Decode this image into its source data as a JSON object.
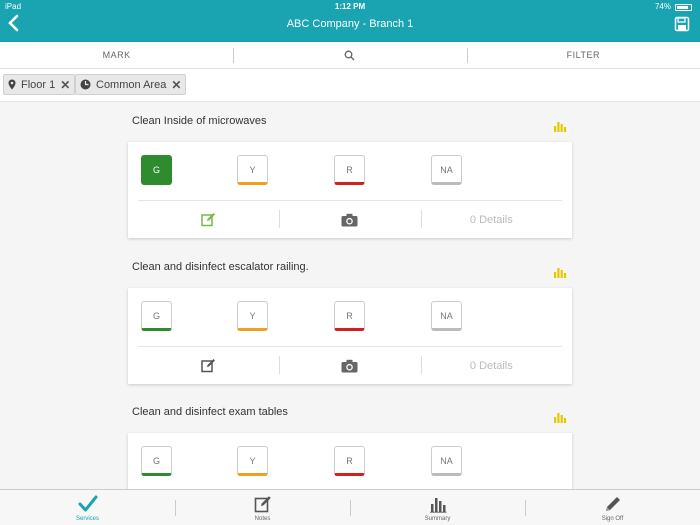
{
  "status": {
    "device": "iPad",
    "time": "1:12 PM",
    "battery": "74%"
  },
  "nav": {
    "title": "ABC Company - Branch 1"
  },
  "actions": {
    "mark": "MARK",
    "filter": "FILTER"
  },
  "chips": [
    {
      "label": "Floor 1",
      "icon": "map-pin-icon"
    },
    {
      "label": "Common Area",
      "icon": "dot-icon"
    }
  ],
  "tasks": [
    {
      "title": "Clean Inside of microwaves",
      "selected": "G"
    },
    {
      "title": "Clean and disinfect escalator railing.",
      "selected": ""
    },
    {
      "title": "Clean and disinfect exam tables",
      "selected": ""
    }
  ],
  "ratings": [
    "G",
    "Y",
    "R",
    "NA"
  ],
  "details_label": "0 Details",
  "colors": {
    "primary": "#1aa3b0",
    "green": "#2e8b2e",
    "yellow": "#f0a020",
    "red": "#d02020",
    "chart": "#e6c800",
    "edit_active": "#7ab648"
  },
  "tabs": [
    {
      "label": "Services",
      "icon": "checkmark-icon",
      "active": true
    },
    {
      "label": "Notes",
      "icon": "notes-icon",
      "active": false
    },
    {
      "label": "Summary",
      "icon": "bar-chart-icon",
      "active": false
    },
    {
      "label": "Sign Off",
      "icon": "pen-icon",
      "active": false
    }
  ]
}
